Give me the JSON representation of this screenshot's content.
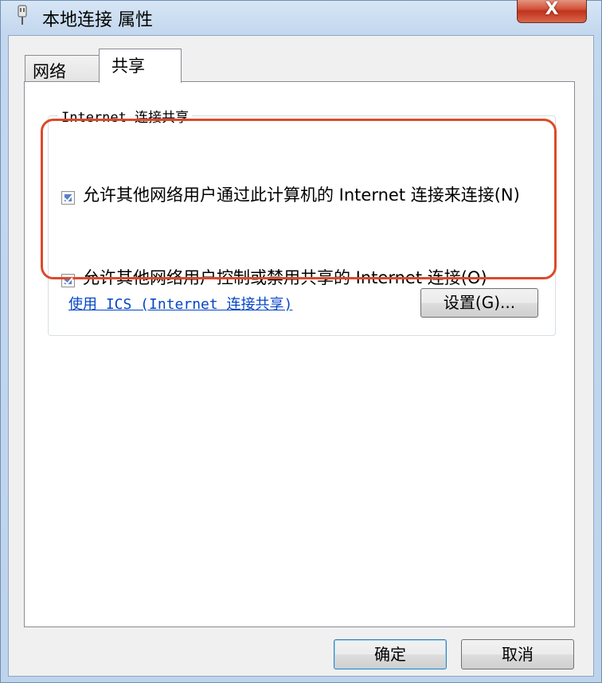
{
  "window": {
    "title": "本地连接 属性",
    "close_symbol": "X"
  },
  "tabs": [
    {
      "label": "网络",
      "selected": false
    },
    {
      "label": "共享",
      "selected": true
    }
  ],
  "group": {
    "legend": "Internet 连接共享",
    "checkboxes": [
      {
        "label": "允许其他网络用户通过此计算机的 Internet 连接来连接(N)",
        "checked": true
      },
      {
        "label": "允许其他网络用户控制或禁用共享的 Internet 连接(O)",
        "checked": true
      }
    ],
    "link": "使用 ICS (Internet 连接共享)",
    "settings_button": "设置(G)..."
  },
  "buttons": {
    "ok": "确定",
    "cancel": "取消"
  },
  "colors": {
    "highlight": "#dc4a2a",
    "link": "#0645c6",
    "close_button": "#c0321d"
  }
}
